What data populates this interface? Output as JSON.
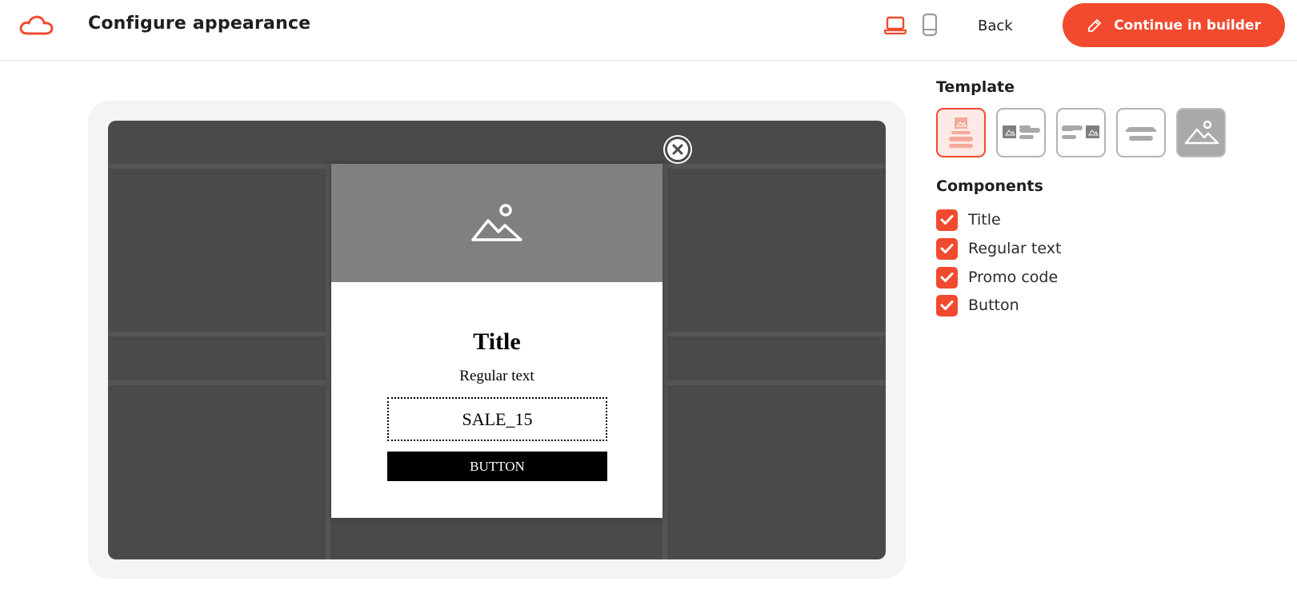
{
  "header": {
    "title": "Configure appearance",
    "back_label": "Back",
    "continue_label": "Continue in builder",
    "logo_icon": "cloud-logo-icon",
    "device_icons": [
      "laptop-icon",
      "mobile-icon"
    ]
  },
  "preview": {
    "popup": {
      "image_icon": "image-placeholder-icon",
      "title": "Title",
      "text": "Regular text",
      "promo_code": "SALE_15",
      "button_label": "BUTTON"
    },
    "close_icon": "close-icon"
  },
  "template_panel": {
    "label": "Template",
    "options": [
      {
        "name": "image-top",
        "selected": true
      },
      {
        "name": "image-left",
        "selected": false
      },
      {
        "name": "image-right",
        "selected": false
      },
      {
        "name": "text-only",
        "selected": false
      },
      {
        "name": "image-only",
        "selected": false
      }
    ]
  },
  "components_panel": {
    "label": "Components",
    "items": [
      {
        "label": "Title",
        "checked": true
      },
      {
        "label": "Regular text",
        "checked": true
      },
      {
        "label": "Promo code",
        "checked": true
      },
      {
        "label": "Button",
        "checked": true
      }
    ]
  },
  "colors": {
    "accent": "#f24a2f",
    "preview_bg": "#4a4a4a",
    "image_placeholder": "#808080"
  }
}
